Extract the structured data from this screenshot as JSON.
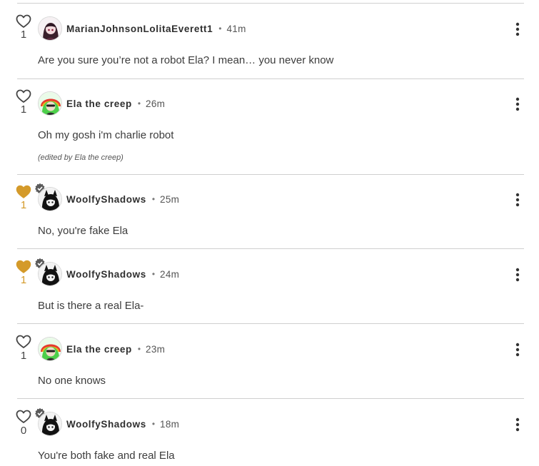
{
  "colors": {
    "liked": "#d49a2a",
    "divider": "#cfcfcf",
    "text": "#3c3c3c"
  },
  "comments": [
    {
      "author": "MarianJohnsonLolitaEverett1",
      "separator": "•",
      "time": "41m",
      "text": "Are you sure you’re not a robot Ela? I mean… you never know",
      "likes": "1",
      "liked": false,
      "avatar_icon": "dark-haired-character-avatar-icon",
      "badge_icon": null
    },
    {
      "author": "Ela the creep",
      "separator": "•",
      "time": "26m",
      "text": "Oh my gosh i'm charlie robot",
      "edited_note": "(edited by Ela the creep)",
      "likes": "1",
      "liked": false,
      "avatar_icon": "green-haired-character-avatar-icon",
      "badge_icon": null
    },
    {
      "author": "WoolfyShadows",
      "separator": "•",
      "time": "25m",
      "text": "No, you're fake Ela",
      "likes": "1",
      "liked": true,
      "avatar_icon": "black-wolf-character-avatar-icon",
      "badge_icon": "verified-gear-badge-icon"
    },
    {
      "author": "WoolfyShadows",
      "separator": "•",
      "time": "24m",
      "text": "But is there a real Ela-",
      "likes": "1",
      "liked": true,
      "avatar_icon": "black-wolf-character-avatar-icon",
      "badge_icon": "verified-gear-badge-icon"
    },
    {
      "author": "Ela the creep",
      "separator": "•",
      "time": "23m",
      "text": "No one knows",
      "likes": "1",
      "liked": false,
      "avatar_icon": "green-haired-character-avatar-icon",
      "badge_icon": null
    },
    {
      "author": "WoolfyShadows",
      "separator": "•",
      "time": "18m",
      "text": "You're both fake and real Ela",
      "likes": "0",
      "liked": false,
      "avatar_icon": "black-wolf-character-avatar-icon",
      "badge_icon": "verified-gear-badge-icon"
    }
  ]
}
